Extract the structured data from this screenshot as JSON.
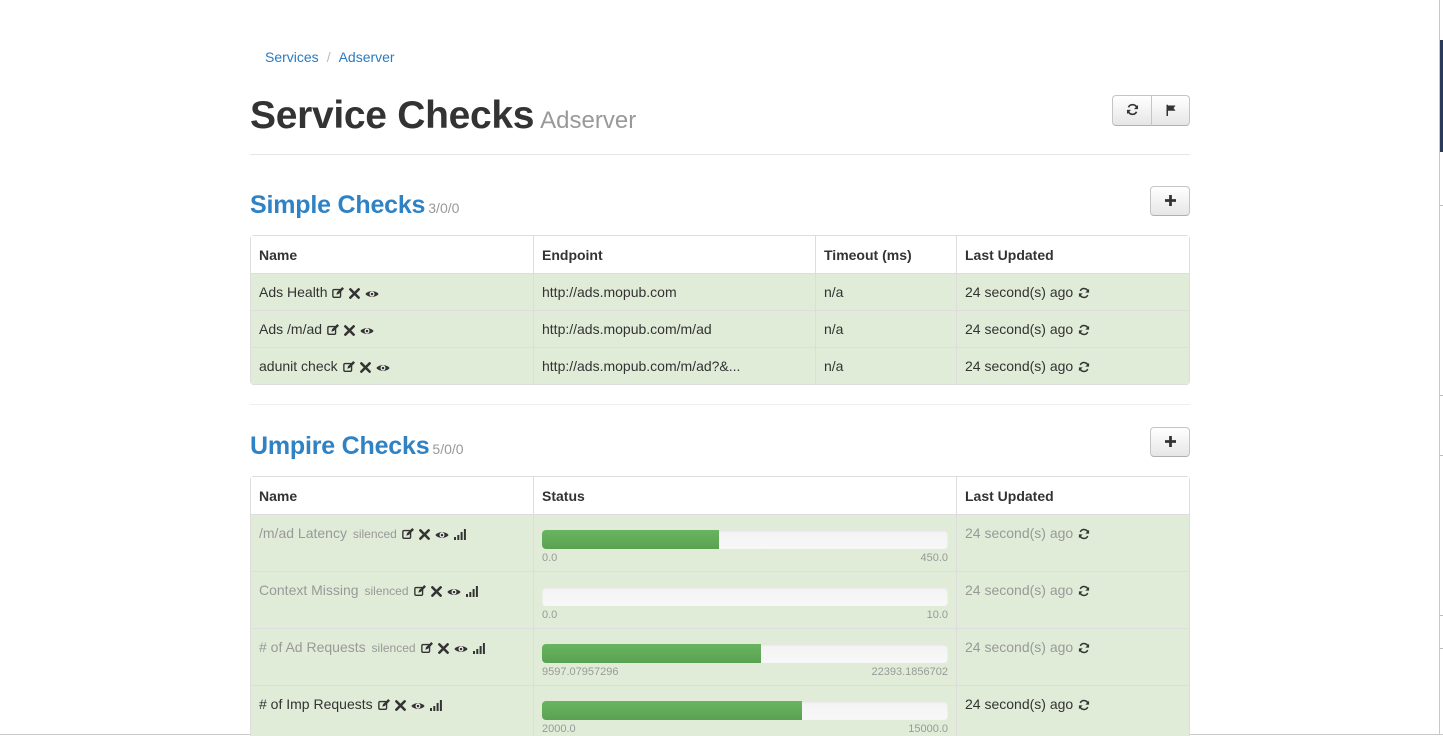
{
  "breadcrumb": {
    "items": [
      "Services",
      "Adserver"
    ],
    "separator": "/"
  },
  "header": {
    "title": "Service Checks",
    "subtitle": "Adserver",
    "refresh_icon": "refresh-icon",
    "flag_icon": "flag-icon"
  },
  "simple": {
    "title": "Simple Checks",
    "counts": "3/0/0",
    "add_icon": "plus-icon",
    "columns": [
      "Name",
      "Endpoint",
      "Timeout (ms)",
      "Last Updated"
    ],
    "rows": [
      {
        "name": "Ads Health",
        "endpoint": "http://ads.mopub.com",
        "timeout": "n/a",
        "updated": "24 second(s) ago"
      },
      {
        "name": "Ads /m/ad",
        "endpoint": "http://ads.mopub.com/m/ad",
        "timeout": "n/a",
        "updated": "24 second(s) ago"
      },
      {
        "name": "adunit check",
        "endpoint": "http://ads.mopub.com/m/ad?&...",
        "timeout": "n/a",
        "updated": "24 second(s) ago"
      }
    ]
  },
  "umpire": {
    "title": "Umpire Checks",
    "counts": "5/0/0",
    "add_icon": "plus-icon",
    "columns": [
      "Name",
      "Status",
      "Last Updated"
    ],
    "rows": [
      {
        "name": "/m/ad Latency",
        "silenced": "silenced",
        "min": "0.0",
        "max": "450.0",
        "progress": 0.435,
        "updated": "24 second(s) ago"
      },
      {
        "name": "Context Missing",
        "silenced": "silenced",
        "min": "0.0",
        "max": "10.0",
        "progress": 0.0,
        "updated": "24 second(s) ago"
      },
      {
        "name": "# of Ad Requests",
        "silenced": "silenced",
        "min": "9597.07957296",
        "max": "22393.1856702",
        "progress": 0.54,
        "updated": "24 second(s) ago"
      },
      {
        "name": "# of Imp Requests",
        "silenced": "",
        "min": "2000.0",
        "max": "15000.0",
        "progress": 0.64,
        "updated": "24 second(s) ago"
      }
    ]
  },
  "colors": {
    "link": "#2a7bbf",
    "section_title": "#2f82c4",
    "row_success": "#e1ecd8",
    "bar_fill": "#62a85a",
    "bar_track": "#f5f5f5"
  }
}
